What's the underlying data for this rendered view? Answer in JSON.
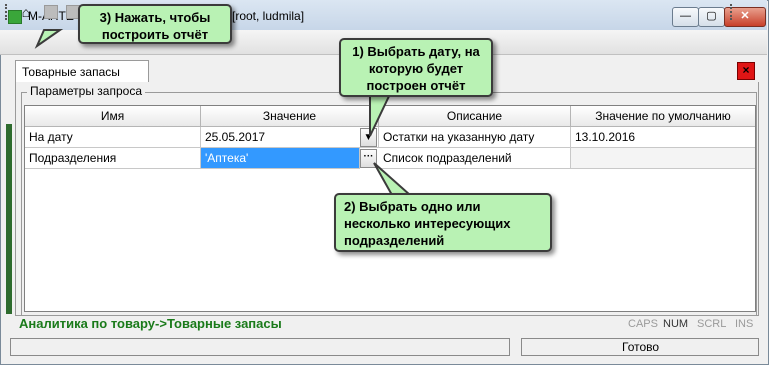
{
  "window": {
    "title": "М-АПТЕ",
    "title_suffix": "[root, ludmila]",
    "min_label": "—",
    "max_label": "▢",
    "close_label": "✕"
  },
  "toolbar": {
    "home_icon": "home-icon",
    "home_glyph": "⌂"
  },
  "tab": {
    "label": "Товарные запасы",
    "close_label": "×"
  },
  "group": {
    "title": "Параметры запроса"
  },
  "grid": {
    "headers": [
      "Имя",
      "Значение",
      "Описание",
      "Значение по умолчанию"
    ],
    "rows": [
      {
        "name": "На дату",
        "value": "25.05.2017",
        "description": "Остатки на указанную дату",
        "default": "13.10.2016",
        "button": "▼"
      },
      {
        "name": "Подразделения",
        "value": "'Аптека'",
        "description": "Список подразделений",
        "default": "",
        "button": "···"
      }
    ]
  },
  "status": {
    "breadcrumb": "Аналитика по товару->Товарные запасы",
    "caps": "CAPS",
    "num": "NUM",
    "scrl": "SCRL",
    "ins": "INS",
    "ready": "Готово"
  },
  "callouts": {
    "c1": "1) Выбрать дату, на которую будет построен отчёт",
    "c2": "2) Выбрать одно или несколько интересующих подразделений",
    "c3": "3) Нажать, чтобы построить отчёт"
  },
  "colors": {
    "callout_bg": "#b9f2b4",
    "selection": "#3399ff",
    "breadcrumb": "#1a7a1a"
  }
}
